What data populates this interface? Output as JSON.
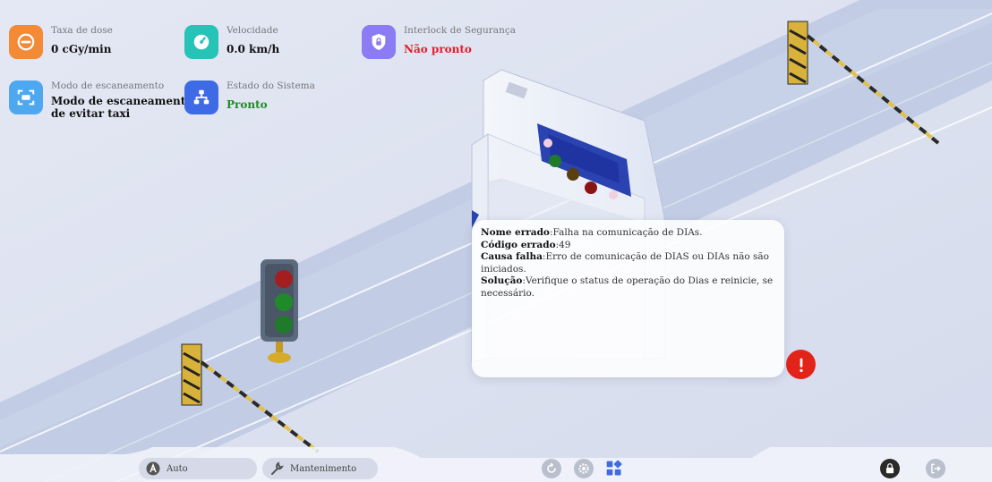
{
  "status": {
    "dose_rate": {
      "label": "Taxa de dose",
      "value": "0 cGy/min"
    },
    "speed": {
      "label": "Velocidade",
      "value": "0.0 km/h"
    },
    "interlock": {
      "label": "Interlock de Segurança",
      "value": "Não pronto"
    },
    "scan_mode": {
      "label": "Modo de escaneamento",
      "value_line1": "Modo de escaneamento",
      "value_line2": "de evitar taxi"
    },
    "system_state": {
      "label": "Estado do Sistema",
      "value": "Pronto"
    }
  },
  "error": {
    "name_label": "Nome errado",
    "name_value": ":Falha na comunicação de DIAs.",
    "code_label": "Código errado",
    "code_value": ":49",
    "cause_label": "Causa falha",
    "cause_value": ":Erro de comunicação de DIAS ou DIAs não são iniciados.",
    "solution_label": "Solução",
    "solution_value": ":Verifique o status de operação do Dias e reinicie, se necessário."
  },
  "bottom": {
    "auto_label": "Auto",
    "maintenance_label": "Mantenimento"
  },
  "colors": {
    "dose_icon": "#f28a36",
    "speed_icon": "#26c4b6",
    "interlock_icon": "#8b7cf3",
    "scan_icon": "#4ea8f0",
    "system_icon": "#3f6ae6",
    "error_red": "#e2231a"
  }
}
